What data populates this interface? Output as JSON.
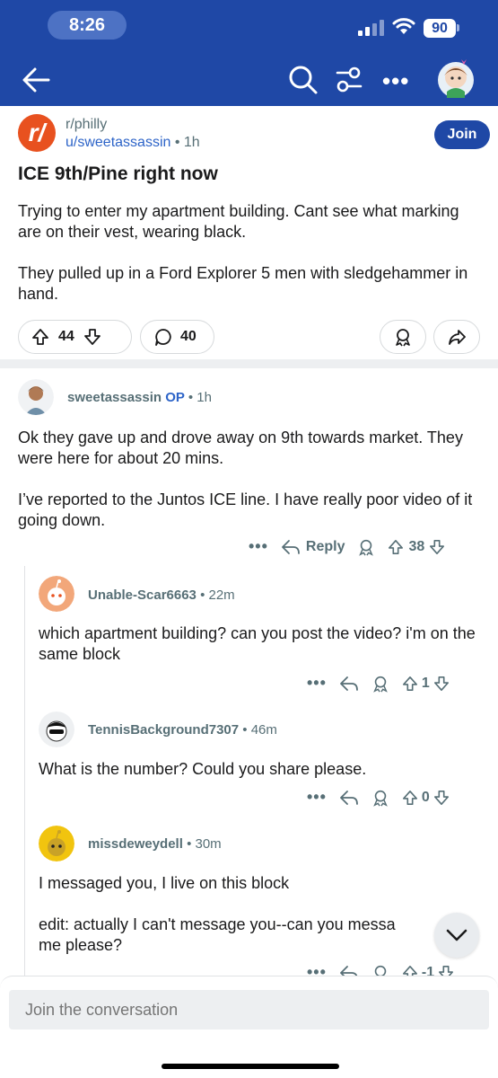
{
  "status_bar": {
    "time": "8:26",
    "battery": "90"
  },
  "post": {
    "subreddit": "r/philly",
    "author": "u/sweetassassin",
    "time": "1h",
    "join_label": "Join",
    "title": "ICE 9th/Pine right now",
    "body": [
      "Trying to enter my apartment building. Cant see what marking are on their vest, wearing black.",
      "They pulled up in a Ford Explorer 5 men with sledgehammer in hand."
    ],
    "upvotes": "44",
    "comments": "40"
  },
  "comments": [
    {
      "author": "sweetassassin",
      "op_badge": "OP",
      "time": "1h",
      "body": [
        "Ok they gave up and drove away on 9th towards market. They were here for about 20 mins.",
        "I’ve reported to the Juntos ICE line. I have really poor video of it going down."
      ],
      "reply_label": "Reply",
      "votes": "38"
    },
    {
      "author": "Unable-Scar6663",
      "time": "22m",
      "body": [
        "which apartment building? can you post the video? i'm on the same block"
      ],
      "votes": "1"
    },
    {
      "author": "TennisBackground7307",
      "time": "46m",
      "body": [
        "What is the number? Could you share please."
      ],
      "votes": "0"
    },
    {
      "author": "missdeweydell",
      "time": "30m",
      "body": [
        "I messaged you, I live on this block",
        "edit: actually I can't message you--can you messa",
        "me please?"
      ],
      "votes": "-1"
    }
  ],
  "composer": {
    "placeholder": "Join the conversation"
  },
  "colors": {
    "header": "#1f48a6",
    "link": "#2d64c8",
    "subreddit_logo": "#e8511f"
  }
}
